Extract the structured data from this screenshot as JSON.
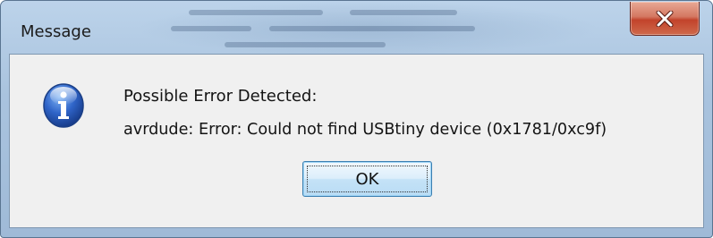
{
  "window": {
    "title": "Message",
    "close_icon": "close-icon"
  },
  "dialog": {
    "icon": "info-icon",
    "line1": "Possible Error Detected:",
    "line2": "avrdude: Error: Could not find USBtiny device (0x1781/0xc9f)",
    "ok_label": "OK"
  },
  "colors": {
    "frame": "#a9c3de",
    "client_background": "#f0f0f0",
    "close_button": "#c2432b",
    "ok_button_border": "#3c7fb1",
    "info_icon": "#2f64c8"
  }
}
